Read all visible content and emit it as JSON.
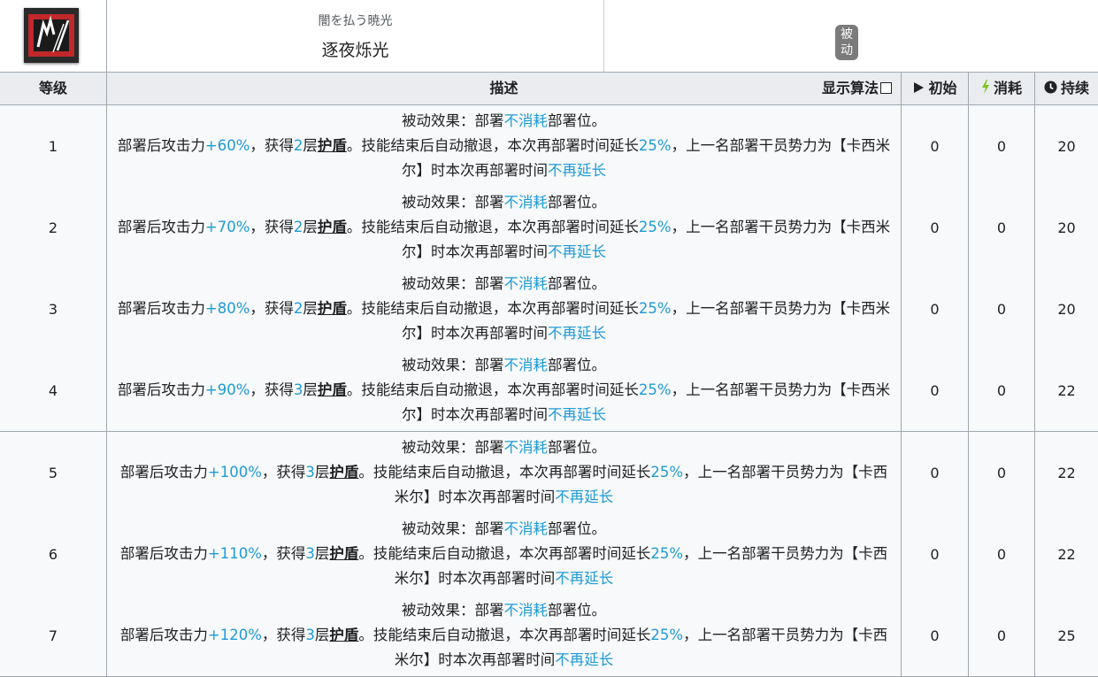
{
  "skill": {
    "name_jp": "闇を払う暁光",
    "name_cn": "逐夜烁光",
    "type_badge": "被动",
    "icon": "skill-icon"
  },
  "table": {
    "headers": {
      "level": "等级",
      "description": "描述",
      "show_formula": "显示算法",
      "initial": "初始",
      "cost": "消耗",
      "duration": "持续"
    },
    "rows": [
      {
        "level": "1",
        "atk": "+60%",
        "layers": "2",
        "init": "0",
        "cost": "0",
        "dur": "20"
      },
      {
        "level": "2",
        "atk": "+70%",
        "layers": "2",
        "init": "0",
        "cost": "0",
        "dur": "20"
      },
      {
        "level": "3",
        "atk": "+80%",
        "layers": "2",
        "init": "0",
        "cost": "0",
        "dur": "20"
      },
      {
        "level": "4",
        "atk": "+90%",
        "layers": "3",
        "init": "0",
        "cost": "0",
        "dur": "22"
      },
      {
        "level": "5",
        "atk": "+100%",
        "layers": "3",
        "init": "0",
        "cost": "0",
        "dur": "22"
      },
      {
        "level": "6",
        "atk": "+110%",
        "layers": "3",
        "init": "0",
        "cost": "0",
        "dur": "22"
      },
      {
        "level": "7",
        "atk": "+120%",
        "layers": "3",
        "init": "0",
        "cost": "0",
        "dur": "25"
      }
    ],
    "desc_text": {
      "passive_prefix": "被动效果：部署",
      "no_cost": "不消耗",
      "passive_suffix": "部署位。",
      "atk_prefix": "部署后攻击力",
      "gain": "，获得",
      "layer": "层",
      "shield": "护盾",
      "mid": "。技能结束后自动撤退，本次再部署时间延长",
      "pct": "25%",
      "tail": "，上一名部署干员势力为【卡西米尔】时本次再部署时间",
      "no_extend": "不再延长"
    }
  },
  "colors": {
    "highlight": "#1d9ad6",
    "header_bg": "#eaecf0",
    "border": "#a2a9b1"
  }
}
